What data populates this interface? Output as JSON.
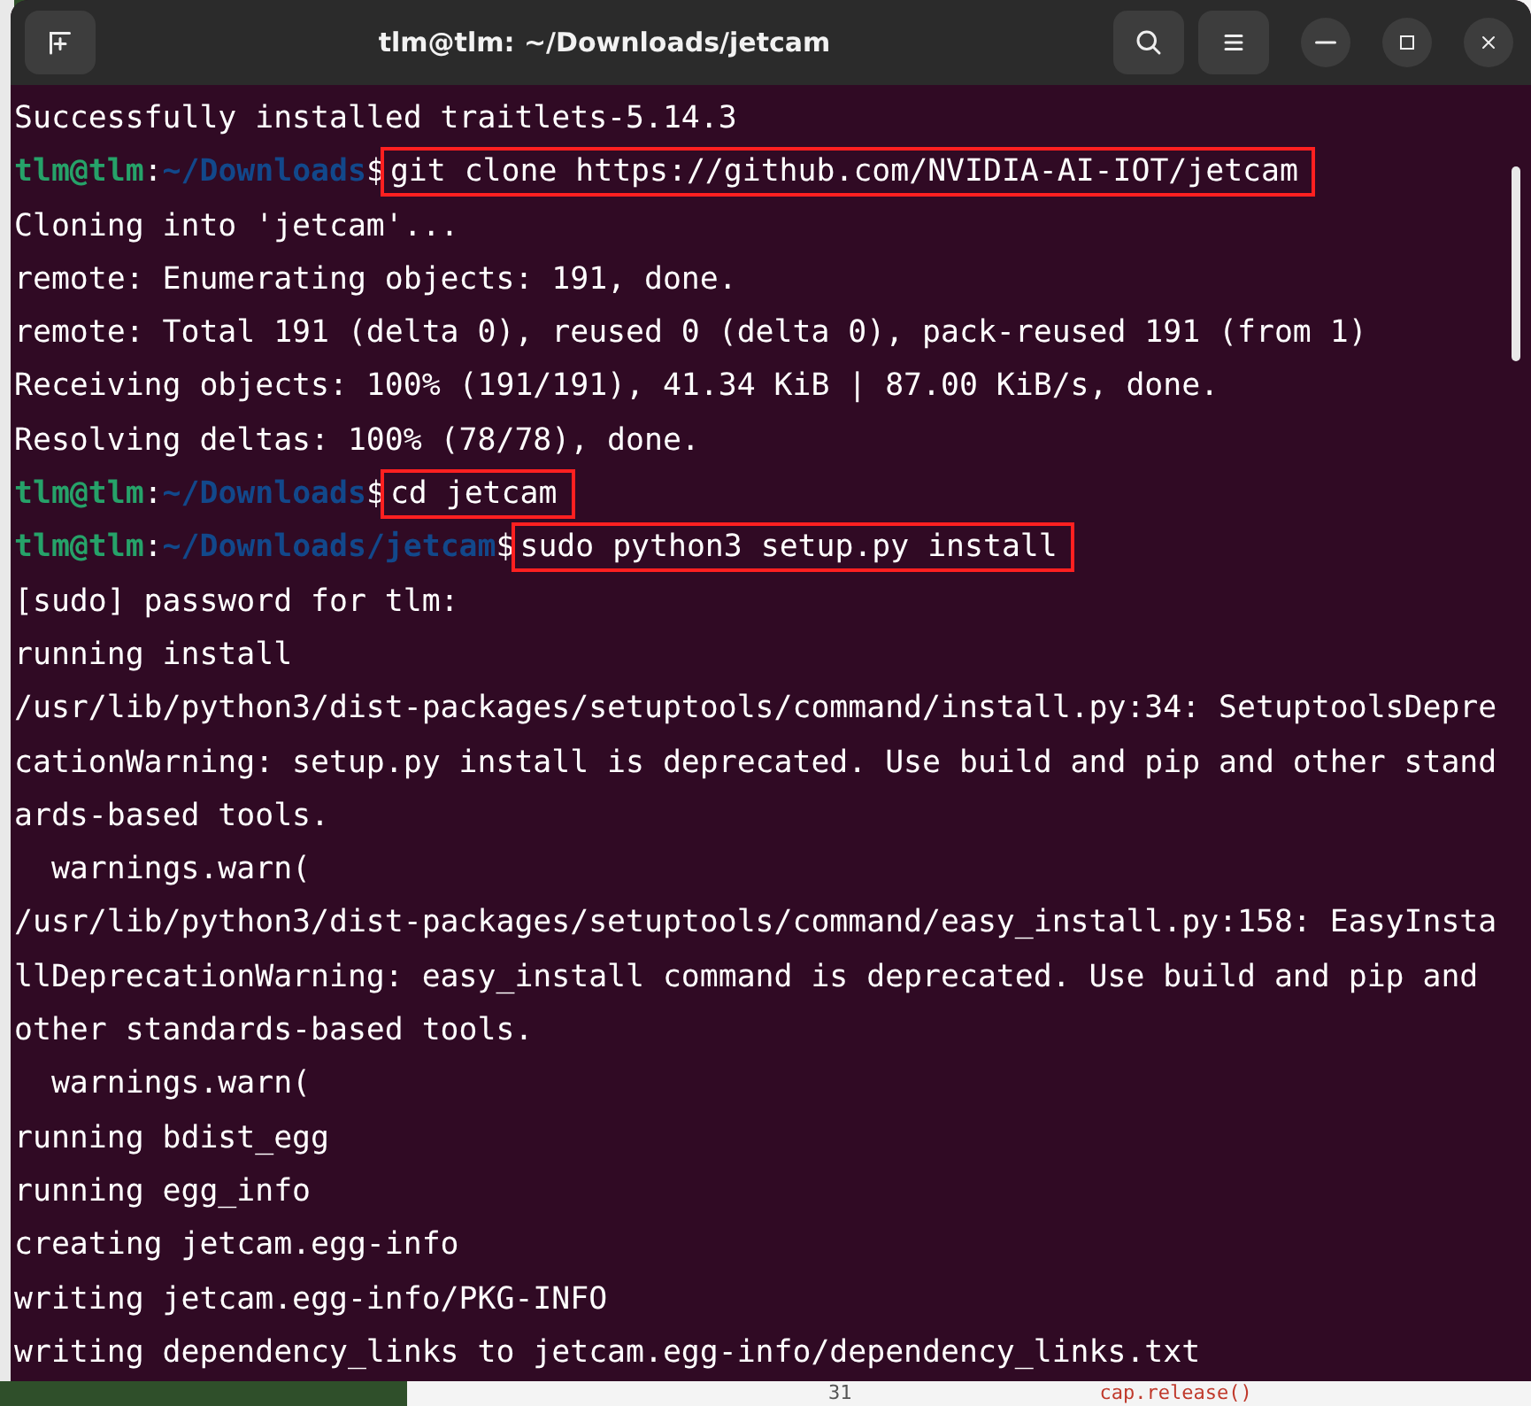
{
  "window": {
    "title": "tlm@tlm: ~/Downloads/jetcam"
  },
  "lines": [
    {
      "kind": "output",
      "text": "Successfully installed traitlets-5.14.3"
    },
    {
      "kind": "prompt",
      "user": "tlm@tlm",
      "separator": ":",
      "path": "~/Downloads",
      "sign": "$",
      "command": "git clone https://github.com/NVIDIA-AI-IOT/jetcam",
      "highlighted": true
    },
    {
      "kind": "output",
      "text": "Cloning into 'jetcam'..."
    },
    {
      "kind": "output",
      "text": "remote: Enumerating objects: 191, done."
    },
    {
      "kind": "output",
      "text": "remote: Total 191 (delta 0), reused 0 (delta 0), pack-reused 191 (from 1)"
    },
    {
      "kind": "output",
      "text": "Receiving objects: 100% (191/191), 41.34 KiB | 87.00 KiB/s, done."
    },
    {
      "kind": "output",
      "text": "Resolving deltas: 100% (78/78), done."
    },
    {
      "kind": "prompt",
      "user": "tlm@tlm",
      "separator": ":",
      "path": "~/Downloads",
      "sign": "$",
      "command": "cd jetcam",
      "highlighted": true
    },
    {
      "kind": "prompt",
      "user": "tlm@tlm",
      "separator": ":",
      "path": "~/Downloads/jetcam",
      "sign": "$",
      "command": "sudo python3 setup.py install",
      "highlighted": true
    },
    {
      "kind": "output",
      "text": "[sudo] password for tlm:"
    },
    {
      "kind": "output",
      "text": "running install"
    },
    {
      "kind": "output",
      "text": "/usr/lib/python3/dist-packages/setuptools/command/install.py:34: SetuptoolsDepre"
    },
    {
      "kind": "output",
      "text": "cationWarning: setup.py install is deprecated. Use build and pip and other stand"
    },
    {
      "kind": "output",
      "text": "ards-based tools."
    },
    {
      "kind": "output",
      "text": "  warnings.warn("
    },
    {
      "kind": "output",
      "text": "/usr/lib/python3/dist-packages/setuptools/command/easy_install.py:158: EasyInsta"
    },
    {
      "kind": "output",
      "text": "llDeprecationWarning: easy_install command is deprecated. Use build and pip and"
    },
    {
      "kind": "output",
      "text": "other standards-based tools."
    },
    {
      "kind": "output",
      "text": "  warnings.warn("
    },
    {
      "kind": "output",
      "text": "running bdist_egg"
    },
    {
      "kind": "output",
      "text": "running egg_info"
    },
    {
      "kind": "output",
      "text": "creating jetcam.egg-info"
    },
    {
      "kind": "output",
      "text": "writing jetcam.egg-info/PKG-INFO"
    },
    {
      "kind": "output",
      "text": "writing dependency_links to jetcam.egg-info/dependency_links.txt"
    }
  ],
  "background_editor": {
    "line_number": "31",
    "code": "cap.release()"
  }
}
